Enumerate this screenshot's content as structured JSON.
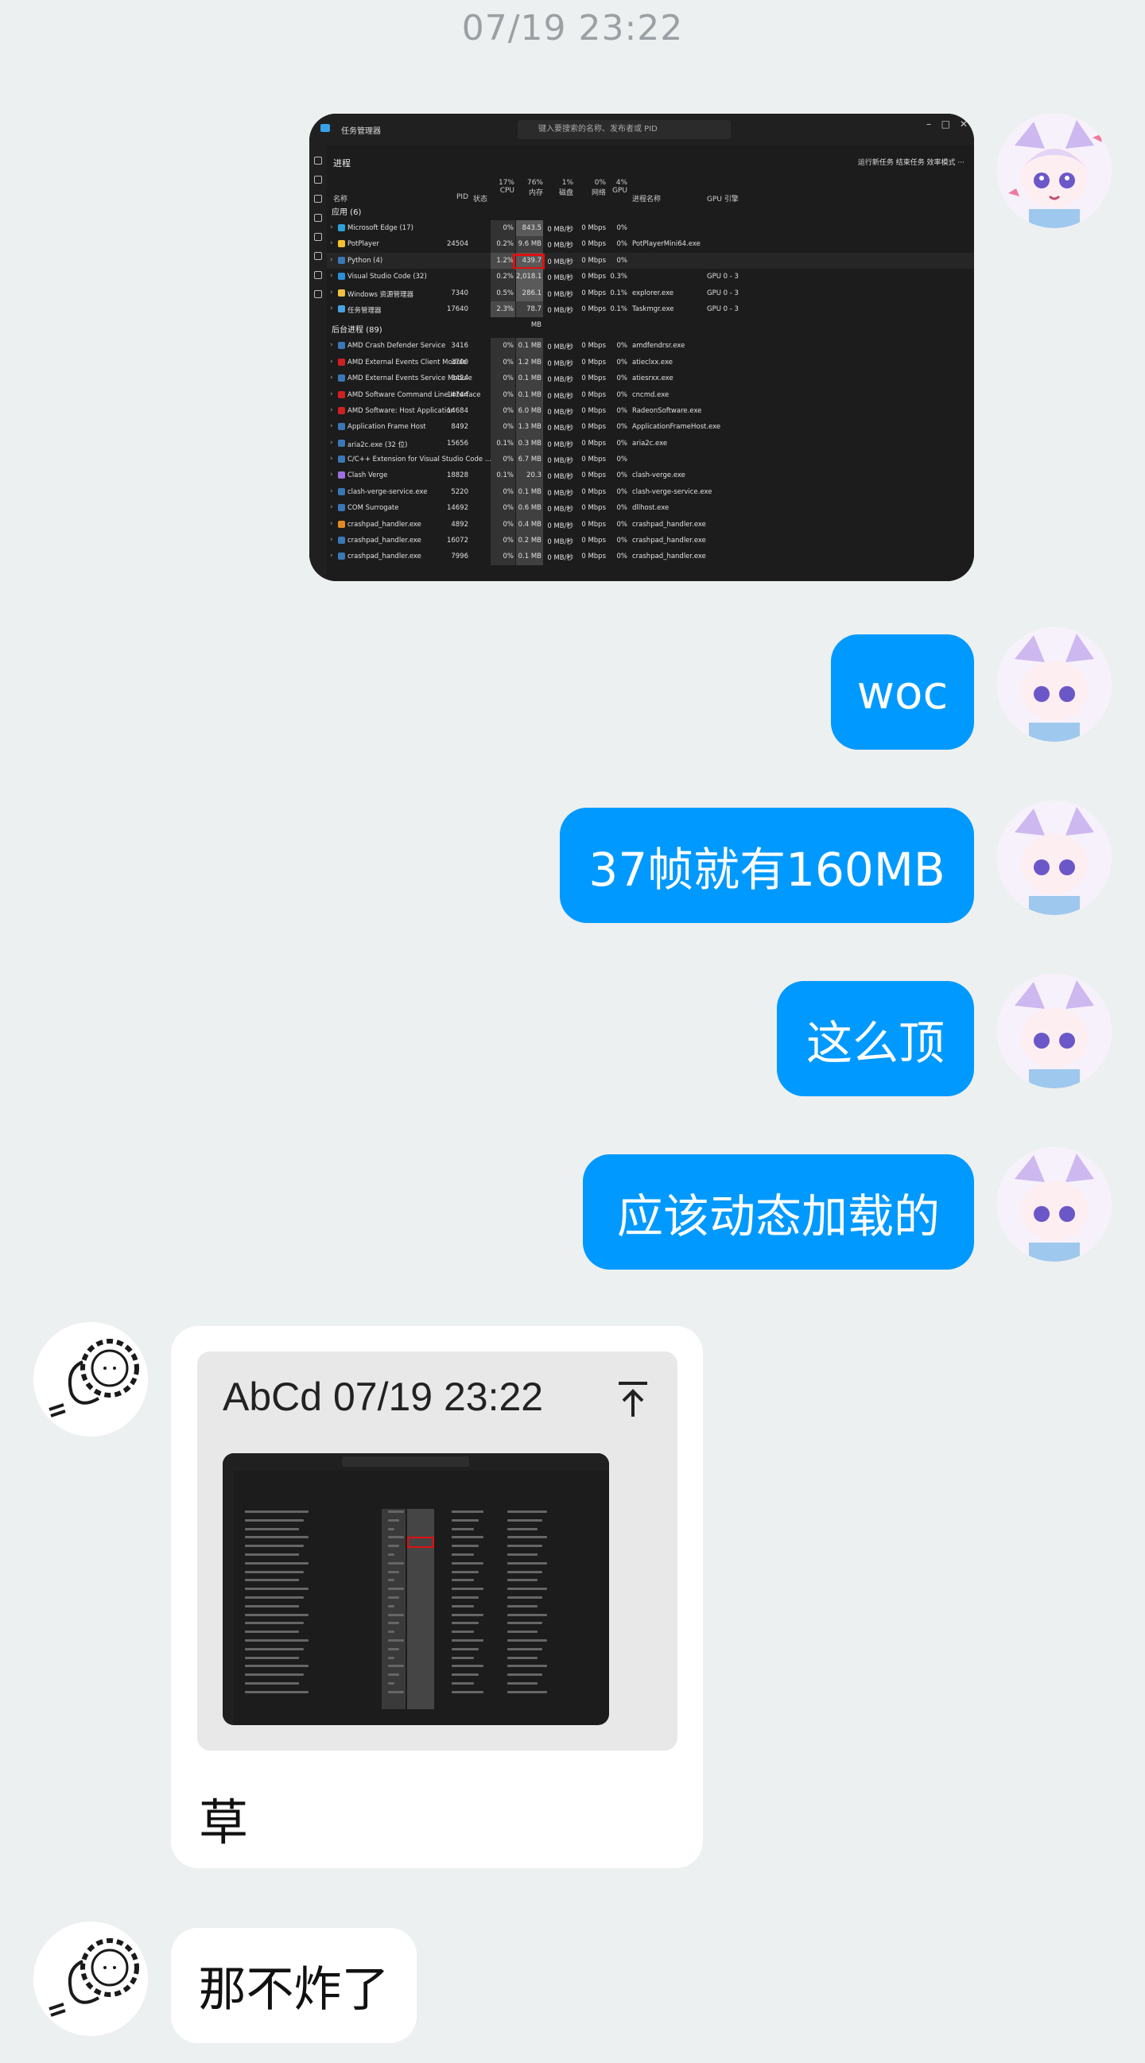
{
  "chat": {
    "timestamp": "07/19 23:22",
    "messages_out": [
      {
        "text": "woc"
      },
      {
        "text": "37帧就有160MB"
      },
      {
        "text": "这么顶"
      },
      {
        "text": "应该动态加载的"
      }
    ],
    "reply": {
      "quote_header": "AbCd 07/19 23:22",
      "text": "草"
    },
    "last_in": {
      "text": "那不炸了"
    }
  },
  "taskmgr": {
    "title": "任务管理器",
    "search_placeholder": "键入要搜索的名称、发布者或 PID",
    "page": "进程",
    "actions": "运行新任务   结束任务   效率模式   ···",
    "col_name": "名称",
    "col_pid": "PID",
    "col_status": "状态",
    "col_cpu": "17%\nCPU",
    "col_mem": "76%\n内存",
    "col_disk": "1%\n磁盘",
    "col_net": "0%\n网络",
    "col_gpu": "4%\nGPU",
    "col_procname": "进程名称",
    "col_gpueng": "GPU 引擎",
    "group_apps": "应用 (6)",
    "group_bg": "后台进程 (89)",
    "apps": [
      {
        "name": "Microsoft Edge (17)",
        "pid": "",
        "cpu": "0%",
        "mem": "843.5 MB",
        "disk": "0 MB/秒",
        "net": "0 Mbps",
        "gpu": "0%",
        "pn": "",
        "ge": "",
        "color": "#2fa0d8"
      },
      {
        "name": "PotPlayer",
        "pid": "24504",
        "cpu": "0.2%",
        "mem": "9.6 MB",
        "disk": "0 MB/秒",
        "net": "0 Mbps",
        "gpu": "0%",
        "pn": "PotPlayerMini64.exe",
        "ge": "",
        "color": "#f2c12e"
      },
      {
        "name": "Python (4)",
        "pid": "",
        "cpu": "1.2%",
        "mem": "439.7 MB",
        "disk": "0 MB/秒",
        "net": "0 Mbps",
        "gpu": "0%",
        "pn": "",
        "ge": "",
        "color": "#3a77b5"
      },
      {
        "name": "Visual Studio Code (32)",
        "pid": "",
        "cpu": "0.2%",
        "mem": "2,018.1 MB",
        "disk": "0 MB/秒",
        "net": "0 Mbps",
        "gpu": "0.3%",
        "pn": "",
        "ge": "GPU 0 - 3",
        "color": "#2a8fd6"
      },
      {
        "name": "Windows 资源管理器",
        "pid": "7340",
        "cpu": "0.5%",
        "mem": "286.1 MB",
        "disk": "0 MB/秒",
        "net": "0 Mbps",
        "gpu": "0.1%",
        "pn": "explorer.exe",
        "ge": "GPU 0 - 3",
        "color": "#f0c040"
      },
      {
        "name": "任务管理器",
        "pid": "17640",
        "cpu": "2.3%",
        "mem": "78.7 MB",
        "disk": "0 MB/秒",
        "net": "0 Mbps",
        "gpu": "0.1%",
        "pn": "Taskmgr.exe",
        "ge": "GPU 0 - 3",
        "color": "#4aa0e0"
      }
    ],
    "bg": [
      {
        "name": "AMD Crash Defender Service",
        "pid": "3416",
        "cpu": "0%",
        "mem": "0.1 MB",
        "disk": "0 MB/秒",
        "net": "0 Mbps",
        "gpu": "0%",
        "pn": "amdfendrsr.exe",
        "color": "#3a77b5"
      },
      {
        "name": "AMD External Events Client Module",
        "pid": "3700",
        "cpu": "0%",
        "mem": "1.2 MB",
        "disk": "0 MB/秒",
        "net": "0 Mbps",
        "gpu": "0%",
        "pn": "atieclxx.exe",
        "color": "#d02020"
      },
      {
        "name": "AMD External Events Service Module",
        "pid": "3424",
        "cpu": "0%",
        "mem": "0.1 MB",
        "disk": "0 MB/秒",
        "net": "0 Mbps",
        "gpu": "0%",
        "pn": "atiesrxx.exe",
        "color": "#3a77b5"
      },
      {
        "name": "AMD Software Command Line Interface",
        "pid": "14744",
        "cpu": "0%",
        "mem": "0.1 MB",
        "disk": "0 MB/秒",
        "net": "0 Mbps",
        "gpu": "0%",
        "pn": "cncmd.exe",
        "color": "#d02020"
      },
      {
        "name": "AMD Software: Host Application",
        "pid": "14684",
        "cpu": "0%",
        "mem": "6.0 MB",
        "disk": "0 MB/秒",
        "net": "0 Mbps",
        "gpu": "0%",
        "pn": "RadeonSoftware.exe",
        "color": "#d02020"
      },
      {
        "name": "Application Frame Host",
        "pid": "8492",
        "cpu": "0%",
        "mem": "1.3 MB",
        "disk": "0 MB/秒",
        "net": "0 Mbps",
        "gpu": "0%",
        "pn": "ApplicationFrameHost.exe",
        "color": "#3a77b5"
      },
      {
        "name": "aria2c.exe (32 位)",
        "pid": "15656",
        "cpu": "0.1%",
        "mem": "0.3 MB",
        "disk": "0 MB/秒",
        "net": "0 Mbps",
        "gpu": "0%",
        "pn": "aria2c.exe",
        "color": "#3a77b5"
      },
      {
        "name": "C/C++ Extension for Visual Studio Code ...",
        "pid": "",
        "cpu": "0%",
        "mem": "6.7 MB",
        "disk": "0 MB/秒",
        "net": "0 Mbps",
        "gpu": "0%",
        "pn": "",
        "color": "#3a77b5"
      },
      {
        "name": "Clash Verge",
        "pid": "18828",
        "cpu": "0.1%",
        "mem": "20.3 MB",
        "disk": "0 MB/秒",
        "net": "0 Mbps",
        "gpu": "0%",
        "pn": "clash-verge.exe",
        "color": "#9b6fe0"
      },
      {
        "name": "clash-verge-service.exe",
        "pid": "5220",
        "cpu": "0%",
        "mem": "0.1 MB",
        "disk": "0 MB/秒",
        "net": "0 Mbps",
        "gpu": "0%",
        "pn": "clash-verge-service.exe",
        "color": "#3a77b5"
      },
      {
        "name": "COM Surrogate",
        "pid": "14692",
        "cpu": "0%",
        "mem": "0.6 MB",
        "disk": "0 MB/秒",
        "net": "0 Mbps",
        "gpu": "0%",
        "pn": "dllhost.exe",
        "color": "#3a77b5"
      },
      {
        "name": "crashpad_handler.exe",
        "pid": "4892",
        "cpu": "0%",
        "mem": "0.4 MB",
        "disk": "0 MB/秒",
        "net": "0 Mbps",
        "gpu": "0%",
        "pn": "crashpad_handler.exe",
        "color": "#e08a20"
      },
      {
        "name": "crashpad_handler.exe",
        "pid": "16072",
        "cpu": "0%",
        "mem": "0.2 MB",
        "disk": "0 MB/秒",
        "net": "0 Mbps",
        "gpu": "0%",
        "pn": "crashpad_handler.exe",
        "color": "#3a77b5"
      },
      {
        "name": "crashpad_handler.exe",
        "pid": "7996",
        "cpu": "0%",
        "mem": "0.1 MB",
        "disk": "0 MB/秒",
        "net": "0 Mbps",
        "gpu": "0%",
        "pn": "crashpad_handler.exe",
        "color": "#3a77b5"
      }
    ]
  }
}
